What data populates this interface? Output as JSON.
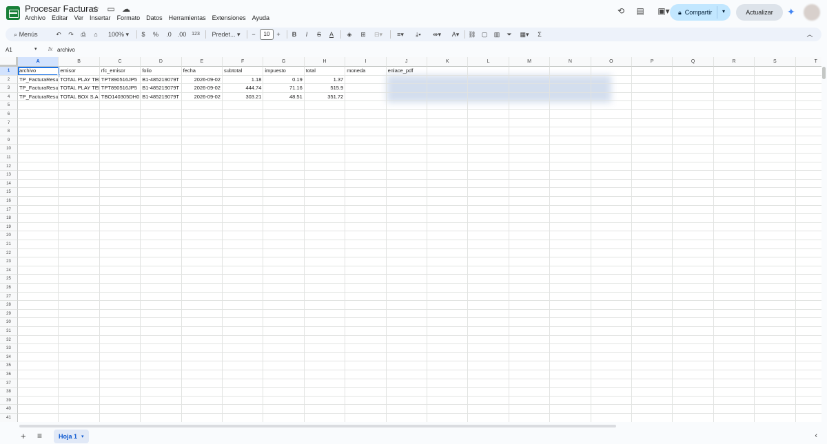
{
  "window": {
    "title": "Procesar Facturas",
    "icons": [
      "star-icon",
      "folder-icon",
      "cloud-icon"
    ]
  },
  "menu": [
    "Archivo",
    "Editar",
    "Ver",
    "Insertar",
    "Formato",
    "Datos",
    "Herramientas",
    "Extensiones",
    "Ayuda"
  ],
  "header": {
    "share_label": "Compartir",
    "update_label": "Actualizar",
    "icons": [
      "history-icon",
      "comment-icon",
      "video-icon",
      "lock-icon",
      "gemini-icon",
      "avatar"
    ]
  },
  "toolbar": {
    "search_label": "Menús",
    "zoom": "100%",
    "currency": "$",
    "percent": "%",
    "dec_decrease": ".0",
    "dec_increase": ".00",
    "format_123": "123",
    "font": "Predet...",
    "font_size": "10",
    "bold": "B",
    "italic": "I",
    "strike": "S",
    "text_color": "A",
    "sigma": "Σ"
  },
  "formula_bar": {
    "cell_ref": "A1",
    "fx": "fx",
    "value": "archivo"
  },
  "columns": [
    "A",
    "B",
    "C",
    "D",
    "E",
    "F",
    "G",
    "H",
    "I",
    "J",
    "K",
    "L",
    "M",
    "N",
    "O",
    "P",
    "Q",
    "R",
    "S",
    "T"
  ],
  "table": {
    "headers": [
      "archivo",
      "emisor",
      "rfc_emisor",
      "folio",
      "fecha",
      "subtotal",
      "impuesto",
      "total",
      "moneda",
      "enlace_pdf"
    ],
    "rows": [
      [
        "TP_FacturaResumen",
        "TOTAL PLAY TELECOMUNICACIONES",
        "TPT890516JP5",
        "B1-485219079T",
        "2026-09-02",
        "1.18",
        "0.19",
        "1.37",
        "",
        ""
      ],
      [
        "TP_FacturaResumen",
        "TOTAL PLAY TELECOMUNICACIONES",
        "TPT890516JP5",
        "B1-485219079T",
        "2026-09-02",
        "444.74",
        "71.16",
        "515.9",
        "",
        ""
      ],
      [
        "TP_FacturaResumen",
        "TOTAL BOX S.A",
        "TBO140305DH0",
        "B1-485219079T",
        "2026-09-02",
        "303.21",
        "48.51",
        "351.72",
        "",
        ""
      ]
    ]
  },
  "sheets": [
    {
      "name": "Hoja 1",
      "active": true
    }
  ],
  "colors": {
    "accent": "#1a73e8",
    "share_button": "#c2e7ff",
    "toolbar_bg": "#edf2fa",
    "selected_header": "#d3e3fd"
  }
}
